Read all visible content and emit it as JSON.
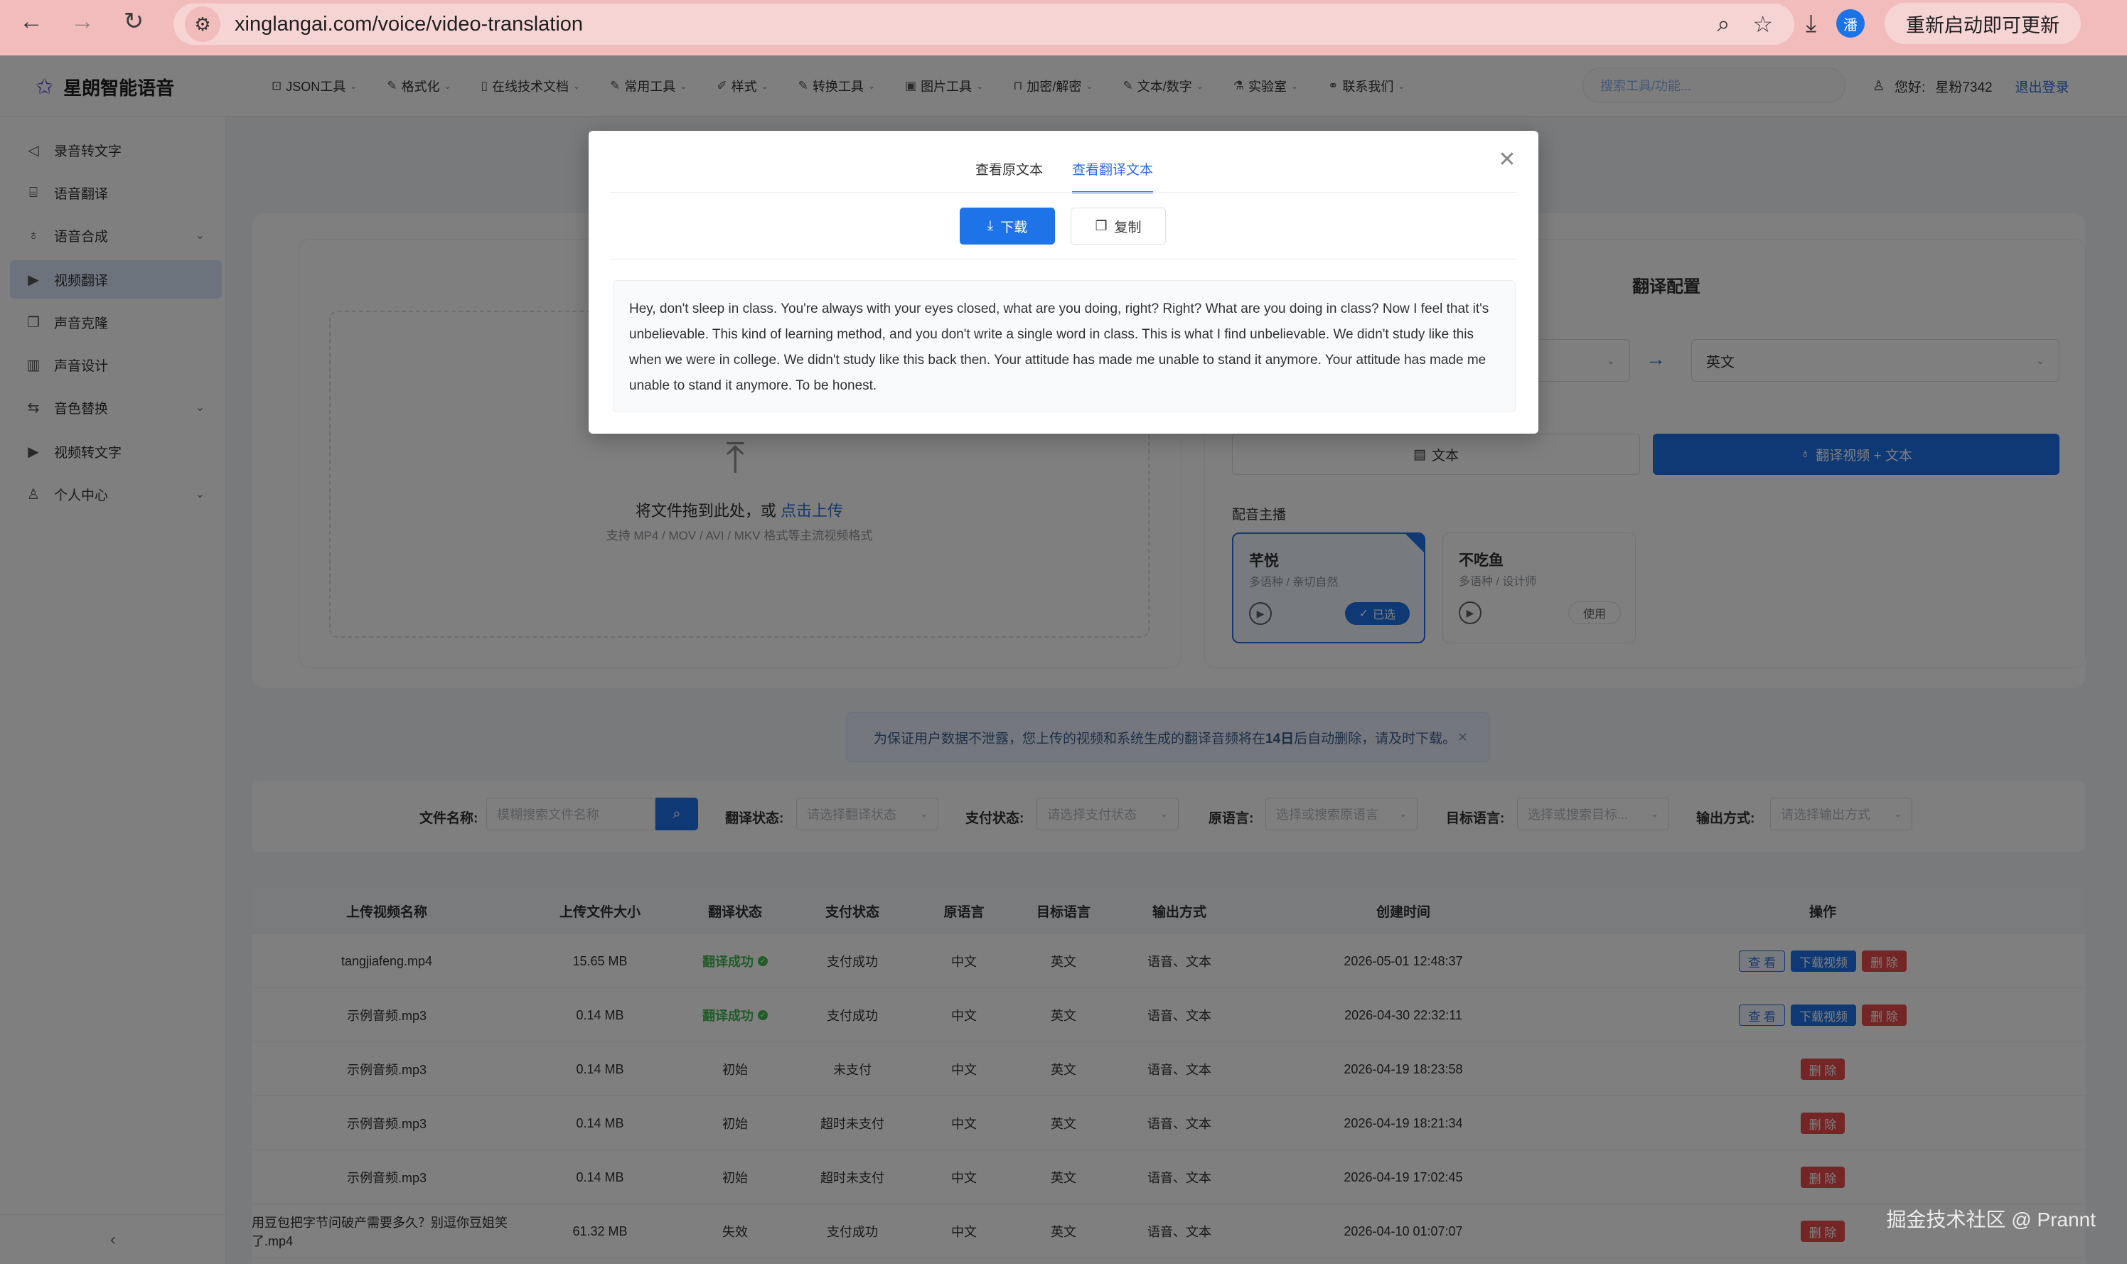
{
  "browser": {
    "url": "xinglangai.com/voice/video-translation",
    "profile_initial": "潘",
    "update_label": "重新启动即可更新"
  },
  "header": {
    "logo": "星朗智能语音",
    "menu": [
      {
        "icon": "terminal-icon",
        "glyph": "⊡",
        "label": "JSON工具"
      },
      {
        "icon": "edit-icon",
        "glyph": "✎",
        "label": "格式化"
      },
      {
        "icon": "doc-icon",
        "glyph": "▯",
        "label": "在线技术文档"
      },
      {
        "icon": "edit-icon",
        "glyph": "✎",
        "label": "常用工具"
      },
      {
        "icon": "brush-icon",
        "glyph": "✐",
        "label": "样式"
      },
      {
        "icon": "edit-icon",
        "glyph": "✎",
        "label": "转换工具"
      },
      {
        "icon": "image-icon",
        "glyph": "▣",
        "label": "图片工具"
      },
      {
        "icon": "lock-icon",
        "glyph": "⊓",
        "label": "加密/解密"
      },
      {
        "icon": "edit-icon",
        "glyph": "✎",
        "label": "文本/数字"
      },
      {
        "icon": "lab-icon",
        "glyph": "⚗",
        "label": "实验室"
      },
      {
        "icon": "link-icon",
        "glyph": "⚭",
        "label": "联系我们"
      }
    ],
    "search_placeholder": "搜索工具/功能...",
    "greeting": "您好:",
    "username": "星粉7342",
    "logout": "退出登录"
  },
  "sidebar": {
    "items": [
      {
        "label": "录音转文字",
        "icon": "volume-icon",
        "glyph": "◁",
        "expand": false,
        "active": false
      },
      {
        "label": "语音翻译",
        "icon": "translate-icon",
        "glyph": "⌸",
        "expand": false,
        "active": false
      },
      {
        "label": "语音合成",
        "icon": "mic-icon",
        "glyph": "♁",
        "expand": true,
        "active": false
      },
      {
        "label": "视频翻译",
        "icon": "video-icon",
        "glyph": "▶",
        "expand": false,
        "active": true
      },
      {
        "label": "声音克隆",
        "icon": "copy-icon",
        "glyph": "❐",
        "expand": false,
        "active": false
      },
      {
        "label": "声音设计",
        "icon": "chart-icon",
        "glyph": "▥",
        "expand": false,
        "active": false
      },
      {
        "label": "音色替换",
        "icon": "repeat-icon",
        "glyph": "⇆",
        "expand": true,
        "active": false
      },
      {
        "label": "视频转文字",
        "icon": "video-icon",
        "glyph": "▶",
        "expand": false,
        "active": false
      },
      {
        "label": "个人中心",
        "icon": "user-icon",
        "glyph": "♙",
        "expand": true,
        "active": false
      }
    ]
  },
  "upload": {
    "text": "将文件拖到此处，或 ",
    "link": "点击上传",
    "sub": "支持 MP4 / MOV / AVI / MKV 格式等主流视频格式"
  },
  "config": {
    "title": "翻译配置",
    "target_lang": "英文",
    "out_text": "文本",
    "out_both": "翻译视频 + 文本",
    "voice_label": "配音主播",
    "voices": [
      {
        "name": "芊悦",
        "desc": "多语种 / 亲切自然",
        "btn": "已选",
        "selected": true
      },
      {
        "name": "不吃鱼",
        "desc": "多语种 / 设计师",
        "btn": "使用",
        "selected": false
      }
    ]
  },
  "notice": {
    "before": "为保证用户数据不泄露，您上传的视频和系统生成的翻译音频将在",
    "highlight": "14日",
    "after": "后自动删除，请及时下载。"
  },
  "filter": {
    "filename_label": "文件名称:",
    "filename_placeholder": "模糊搜索文件名称",
    "status_label": "翻译状态:",
    "status_placeholder": "请选择翻译状态",
    "pay_label": "支付状态:",
    "pay_placeholder": "请选择支付状态",
    "src_label": "原语言:",
    "src_placeholder": "选择或搜索原语言",
    "tgt_label": "目标语言:",
    "tgt_placeholder": "选择或搜索目标...",
    "out_label": "输出方式:",
    "out_placeholder": "请选择输出方式"
  },
  "table": {
    "headers": [
      "上传视频名称",
      "上传文件大小",
      "翻译状态",
      "支付状态",
      "原语言",
      "目标语言",
      "输出方式",
      "创建时间",
      "操作"
    ],
    "rows": [
      {
        "name": "tangjiafeng.mp4",
        "size": "15.65 MB",
        "status": "翻译成功",
        "ok": true,
        "pay": "支付成功",
        "src": "中文",
        "tgt": "英文",
        "out": "语音、文本",
        "time": "2026-05-01 12:48:37",
        "actions": [
          "查 看",
          "下载视频",
          "删 除"
        ]
      },
      {
        "name": "示例音频.mp3",
        "size": "0.14 MB",
        "status": "翻译成功",
        "ok": true,
        "pay": "支付成功",
        "src": "中文",
        "tgt": "英文",
        "out": "语音、文本",
        "time": "2026-04-30 22:32:11",
        "actions": [
          "查 看",
          "下载视频",
          "删 除"
        ]
      },
      {
        "name": "示例音频.mp3",
        "size": "0.14 MB",
        "status": "初始",
        "ok": false,
        "pay": "未支付",
        "src": "中文",
        "tgt": "英文",
        "out": "语音、文本",
        "time": "2026-04-19 18:23:58",
        "actions": [
          "删 除"
        ]
      },
      {
        "name": "示例音频.mp3",
        "size": "0.14 MB",
        "status": "初始",
        "ok": false,
        "pay": "超时未支付",
        "src": "中文",
        "tgt": "英文",
        "out": "语音、文本",
        "time": "2026-04-19 18:21:34",
        "actions": [
          "删 除"
        ]
      },
      {
        "name": "示例音频.mp3",
        "size": "0.14 MB",
        "status": "初始",
        "ok": false,
        "pay": "超时未支付",
        "src": "中文",
        "tgt": "英文",
        "out": "语音、文本",
        "time": "2026-04-19 17:02:45",
        "actions": [
          "删 除"
        ]
      },
      {
        "name": "用豆包把字节问破产需要多久？别逗你豆姐笑了.mp4",
        "size": "61.32 MB",
        "status": "失效",
        "ok": false,
        "pay": "支付成功",
        "src": "中文",
        "tgt": "英文",
        "out": "语音、文本",
        "time": "2026-04-10 01:07:07",
        "actions": [
          "删 除"
        ]
      }
    ]
  },
  "modal": {
    "tab_original": "查看原文本",
    "tab_translated": "查看翻译文本",
    "download": "下载",
    "copy": "复制",
    "text": "Hey, don't sleep in class. You're always with your eyes closed, what are you doing, right? Right? What are you doing in class? Now I feel that it's unbelievable. This kind of learning method, and you don't write a single word in class. This is what I find unbelievable. We didn't study like this when we were in college. We didn't study like this back then. Your attitude has made me unable to stand it anymore. Your attitude has made me unable to stand it anymore. To be honest."
  },
  "watermark": "掘金技术社区 @ Prannt"
}
